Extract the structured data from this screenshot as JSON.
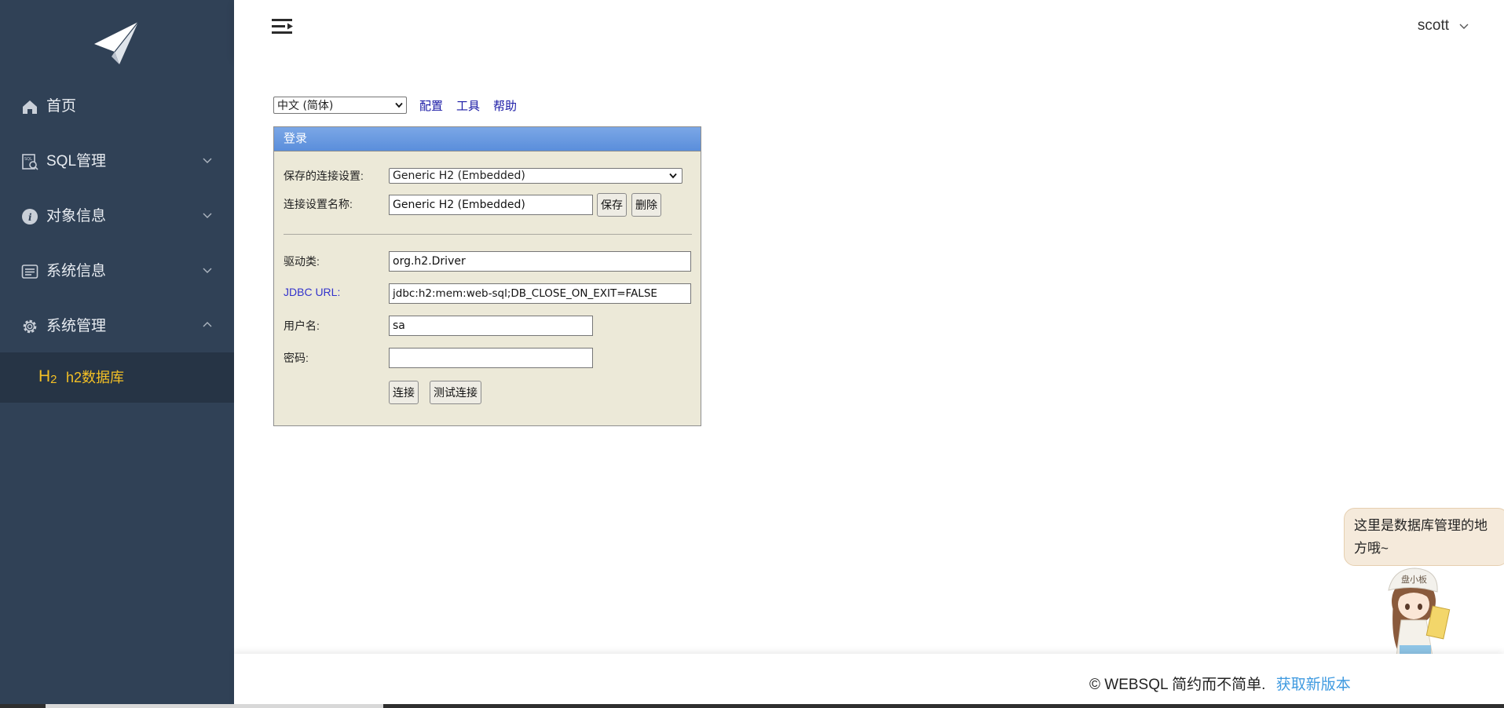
{
  "sidebar": {
    "logo": "paper-plane-logo",
    "items": [
      {
        "label": "首页",
        "icon": "home-icon",
        "expandable": false
      },
      {
        "label": "SQL管理",
        "icon": "sql-icon",
        "expandable": true,
        "expanded": false
      },
      {
        "label": "对象信息",
        "icon": "info-icon",
        "expandable": true,
        "expanded": false
      },
      {
        "label": "系统信息",
        "icon": "list-icon",
        "expandable": true,
        "expanded": false
      },
      {
        "label": "系统管理",
        "icon": "gear-icon",
        "expandable": true,
        "expanded": true
      }
    ],
    "sub_item": {
      "label": "h2数据库",
      "icon_text": "H",
      "icon_sub": "2"
    },
    "colors": {
      "background": "#304156",
      "active_text": "#f4c025"
    }
  },
  "header": {
    "menu_icon": "hamburger-icon",
    "user": "scott"
  },
  "toolbar": {
    "language": "中文 (简体)",
    "links": [
      "配置",
      "工具",
      "帮助"
    ]
  },
  "login": {
    "title": "登录",
    "saved_settings_label": "保存的连接设置:",
    "saved_settings_value": "Generic H2 (Embedded)",
    "setting_name_label": "连接设置名称:",
    "setting_name_value": "Generic H2 (Embedded)",
    "save_button": "保存",
    "delete_button": "删除",
    "driver_label": "驱动类:",
    "driver_value": "org.h2.Driver",
    "jdbc_label": "JDBC URL:",
    "jdbc_value": "jdbc:h2:mem:web-sql;DB_CLOSE_ON_EXIT=FALSE",
    "user_label": "用户名:",
    "user_value": "sa",
    "password_label": "密码:",
    "password_value": "",
    "connect_button": "连接",
    "test_button": "测试连接"
  },
  "bubble": {
    "line1": "这里是数据库管理的地",
    "line2": "方哦~"
  },
  "footer": {
    "copyright": "© WEBSQL 简约而不简单.",
    "link": "获取新版本"
  }
}
